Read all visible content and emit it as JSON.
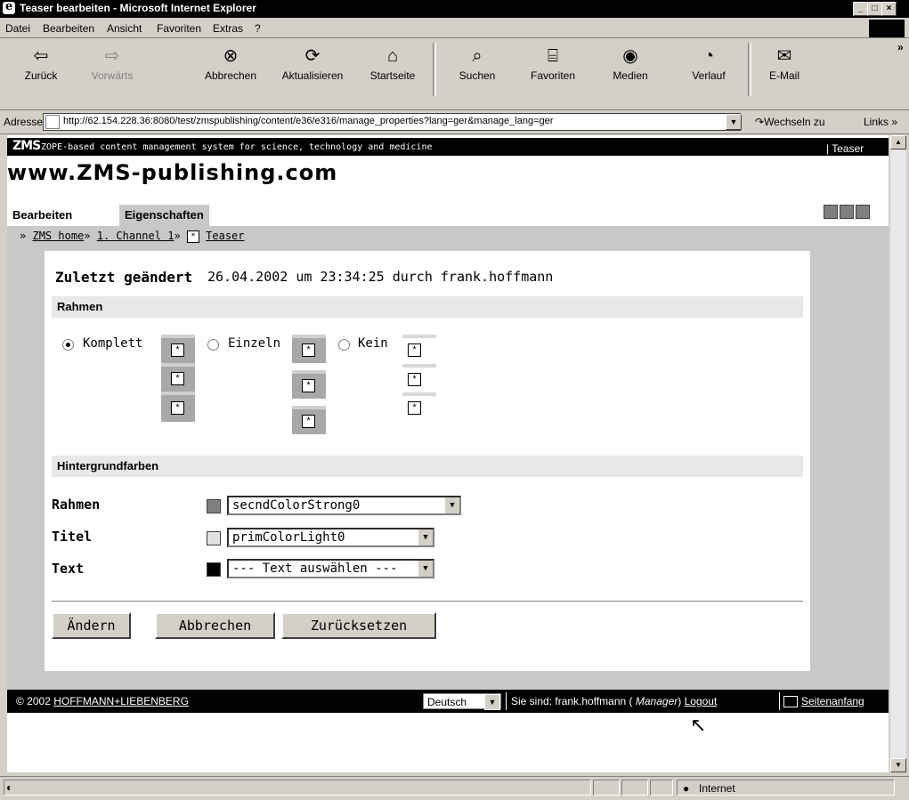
{
  "window": {
    "title": "Teaser bearbeiten - Microsoft Internet Explorer"
  },
  "menubar": {
    "items": [
      "Datei",
      "Bearbeiten",
      "Ansicht",
      "Favoriten",
      "Extras",
      "?"
    ]
  },
  "toolbar": {
    "back": "Zurück",
    "forward": "Vorwärts",
    "stop": "Abbrechen",
    "refresh": "Aktualisieren",
    "home": "Startseite",
    "search": "Suchen",
    "favorites": "Favoriten",
    "media": "Medien",
    "history": "Verlauf",
    "mail": "E-Mail"
  },
  "address": {
    "label": "Adresse",
    "url": "http://62.154.228.36:8080/test/zmspublishing/content/e36/e316/manage_properties?lang=ger&manage_lang=ger",
    "go": "Wechseln zu",
    "links": "Links"
  },
  "zms": {
    "logo": "ZMS",
    "tagline": "ZOPE-based content management system for science, technology and medicine",
    "context": "| Teaser",
    "site": "www.ZMS-publishing.com"
  },
  "tabs": {
    "edit": "Bearbeiten",
    "properties": "Eigenschaften"
  },
  "breadcrumb": {
    "sep1": "»",
    "home": "ZMS home",
    "sep2": "»",
    "channel": "1. Channel 1",
    "sep3": "»",
    "current": "Teaser"
  },
  "lastchange": {
    "label": "Zuletzt geändert",
    "value": "26.04.2002 um 23:34:25 durch frank.hoffmann"
  },
  "frame_section": {
    "title": "Rahmen",
    "options": [
      {
        "label": "Komplett",
        "selected": true
      },
      {
        "label": "Einzeln",
        "selected": false
      },
      {
        "label": "Kein",
        "selected": false
      }
    ]
  },
  "colors_section": {
    "title": "Hintergrundfarben",
    "rows": [
      {
        "label": "Rahmen",
        "value": "secndColorStrong0",
        "swatch": "#808080"
      },
      {
        "label": "Titel",
        "value": "primColorLight0",
        "swatch": "#e0e0e0"
      },
      {
        "label": "Text",
        "value": "--- Text auswählen ---",
        "swatch": "#000000"
      }
    ]
  },
  "buttons": {
    "change": "Ändern",
    "cancel": "Abbrechen",
    "reset": "Zurücksetzen"
  },
  "footer": {
    "copyright_prefix": "© 2002",
    "company": "HOFFMANN+LIEBENBERG",
    "language": "Deutsch",
    "user_prefix": "Sie sind: frank.hoffmann (",
    "role": "Manager",
    "user_suffix": ")",
    "logout": "Logout",
    "top": "Seitenanfang"
  },
  "status": {
    "zone": "Internet"
  }
}
